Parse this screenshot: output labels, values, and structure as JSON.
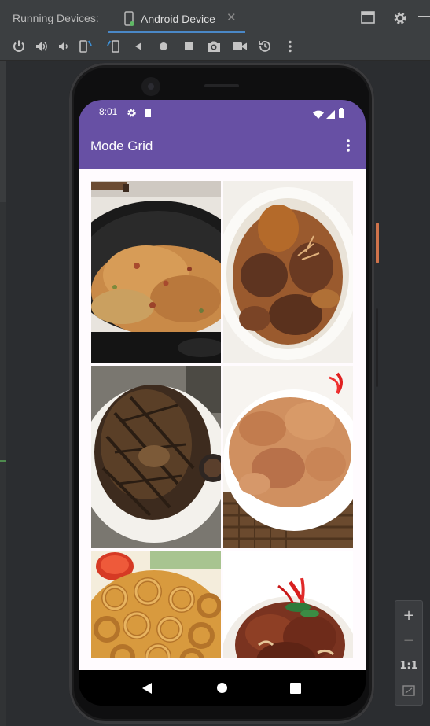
{
  "ide": {
    "running_label": "Running Devices:",
    "device_tab_label": "Android Device",
    "close_glyph": "✕",
    "toolbar_icons": [
      "power-icon",
      "volume-up-icon",
      "volume-down-icon",
      "rotate-left-icon",
      "rotate-right-icon",
      "back-icon",
      "home-icon",
      "overview-icon",
      "camera-icon",
      "video-icon",
      "history-icon",
      "more-vert-icon"
    ],
    "zoom": {
      "in": "+",
      "out": "−",
      "reset": "1:1"
    }
  },
  "phone": {
    "status": {
      "time": "8:01"
    },
    "app_title": "Mode Grid",
    "colors": {
      "primary": "#6750a4",
      "background": "#fffbfe"
    },
    "grid_items": [
      {
        "icon": "fried-rice-photo"
      },
      {
        "icon": "beef-stew-photo"
      },
      {
        "icon": "grilled-fish-photo"
      },
      {
        "icon": "chicken-curry-photo"
      },
      {
        "icon": "fried-squid-photo"
      },
      {
        "icon": "braised-meat-photo"
      }
    ],
    "nav": [
      "back-icon",
      "home-icon",
      "recents-icon"
    ]
  }
}
